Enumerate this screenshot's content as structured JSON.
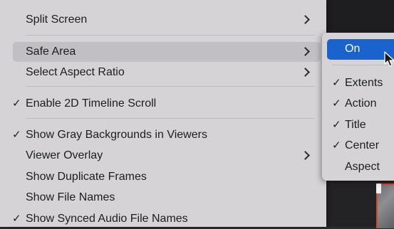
{
  "main_menu": {
    "items": [
      {
        "label": "Split Screen",
        "checked": false,
        "submenu": true
      },
      {
        "label": "Safe Area",
        "checked": false,
        "submenu": true,
        "highlighted": true
      },
      {
        "label": "Select Aspect Ratio",
        "checked": false,
        "submenu": true
      },
      {
        "label": "Enable 2D Timeline Scroll",
        "checked": true,
        "submenu": false
      },
      {
        "label": "Show Gray Backgrounds in Viewers",
        "checked": true,
        "submenu": false
      },
      {
        "label": "Viewer Overlay",
        "checked": false,
        "submenu": true
      },
      {
        "label": "Show Duplicate Frames",
        "checked": false,
        "submenu": false
      },
      {
        "label": "Show File Names",
        "checked": false,
        "submenu": false
      },
      {
        "label": "Show Synced Audio File Names",
        "checked": true,
        "submenu": false
      }
    ]
  },
  "safe_area_submenu": {
    "items": [
      {
        "label": "On",
        "checked": false,
        "highlighted": true
      },
      {
        "label": "Extents",
        "checked": true
      },
      {
        "label": "Action",
        "checked": true
      },
      {
        "label": "Title",
        "checked": true
      },
      {
        "label": "Center",
        "checked": true
      },
      {
        "label": "Aspect",
        "checked": false
      }
    ]
  },
  "glyphs": {
    "check": "✓"
  },
  "colors": {
    "menu_bg": "#d5d3d6",
    "highlight_blue": "#1a62cd",
    "hover_gray": "#c1bfc3"
  }
}
